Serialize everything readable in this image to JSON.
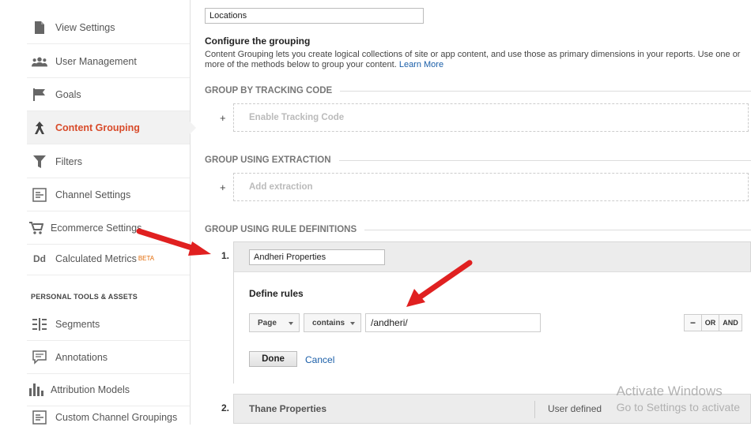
{
  "sidebar": {
    "items": [
      {
        "label": "View Settings",
        "icon": "page-icon"
      },
      {
        "label": "User Management",
        "icon": "users-icon"
      },
      {
        "label": "Goals",
        "icon": "flag-icon"
      },
      {
        "label": "Content Grouping",
        "icon": "content-grouping-icon",
        "active": true
      },
      {
        "label": "Filters",
        "icon": "funnel-icon"
      },
      {
        "label": "Channel Settings",
        "icon": "channel-icon"
      },
      {
        "label": "Ecommerce Settings",
        "icon": "cart-icon"
      },
      {
        "label": "Calculated Metrics",
        "icon": "dd-icon",
        "badge": "BETA"
      }
    ],
    "section_title": "PERSONAL TOOLS & ASSETS",
    "tools": [
      {
        "label": "Segments",
        "icon": "segments-icon"
      },
      {
        "label": "Annotations",
        "icon": "annotation-icon"
      },
      {
        "label": "Attribution Models",
        "icon": "bar-chart-icon"
      },
      {
        "label": "Custom Channel Groupings",
        "icon": "channel-icon"
      }
    ]
  },
  "main": {
    "name_value": "Locations",
    "configure_title": "Configure the grouping",
    "configure_desc": "Content Grouping lets you create logical collections of site or app content, and use those as primary dimensions in your reports. Use one or more of the methods below to group your content.",
    "learn_more": "Learn More",
    "tracking": {
      "header": "GROUP BY TRACKING CODE",
      "plus": "+",
      "action": "Enable Tracking Code"
    },
    "extraction": {
      "header": "GROUP USING EXTRACTION",
      "plus": "+",
      "action": "Add extraction"
    },
    "rules": {
      "header": "GROUP USING RULE DEFINITIONS",
      "rule1": {
        "number": "1.",
        "name": "Andheri Properties",
        "define_label": "Define rules",
        "dimension": "Page",
        "operator": "contains",
        "value": "/andheri/",
        "minus": "−",
        "or": "OR",
        "and": "AND",
        "done": "Done",
        "cancel": "Cancel"
      },
      "rule2": {
        "number": "2.",
        "name": "Thane Properties",
        "type": "User defined"
      }
    }
  },
  "watermark": {
    "line1": "Activate Windows",
    "line2": "Go to Settings to activate"
  },
  "colors": {
    "accent": "#d84b2a",
    "link": "#1a5ea8",
    "annotation_arrow": "#e02020"
  }
}
